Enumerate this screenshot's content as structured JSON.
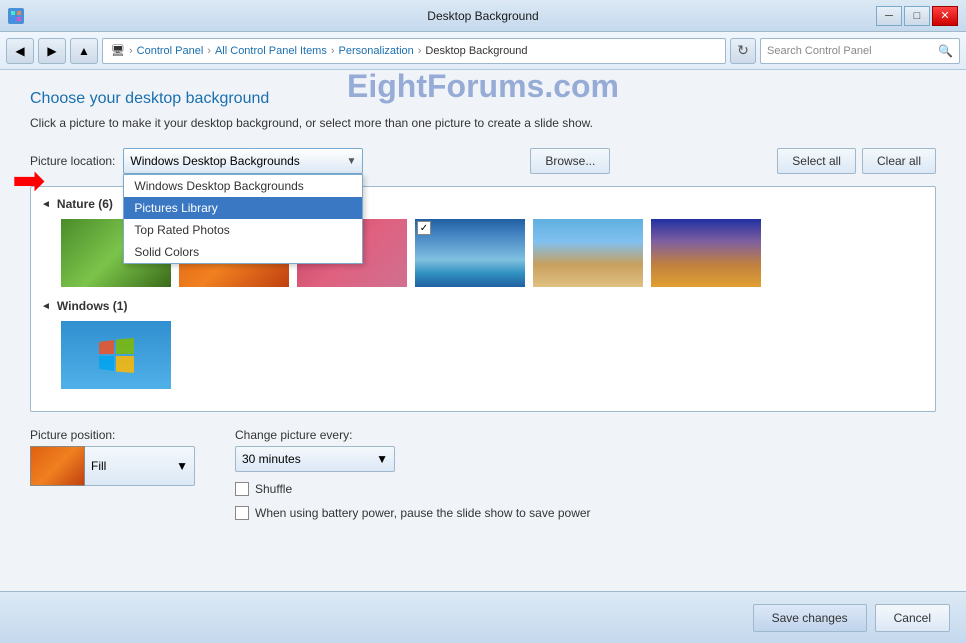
{
  "window": {
    "title": "Desktop Background",
    "icon": "🖥"
  },
  "titlebar_buttons": {
    "minimize": "─",
    "maximize": "□",
    "close": "✕"
  },
  "addressbar": {
    "breadcrumb": [
      "Control Panel",
      "All Control Panel Items",
      "Personalization",
      "Desktop Background"
    ],
    "search_placeholder": "Search Control Panel"
  },
  "page": {
    "title": "Choose your desktop background",
    "subtitle": "Click a picture to make it your desktop background, or select more than one picture to create a slide show."
  },
  "picture_location": {
    "label": "Picture location:",
    "selected": "Windows Desktop Backgrounds",
    "options": [
      "Windows Desktop Backgrounds",
      "Pictures Library",
      "Top Rated Photos",
      "Solid Colors"
    ]
  },
  "buttons": {
    "browse": "Browse...",
    "select_all": "Select all",
    "clear_all": "Clear all",
    "save_changes": "Save changes",
    "cancel": "Cancel"
  },
  "groups": [
    {
      "name": "Nature (6)",
      "images": 6
    },
    {
      "name": "Windows (1)",
      "images": 1
    }
  ],
  "picture_position": {
    "label": "Picture position:",
    "value": "Fill"
  },
  "change_picture": {
    "label": "Change picture every:",
    "value": "30 minutes"
  },
  "shuffle": {
    "label": "Shuffle",
    "checked": false
  },
  "battery": {
    "label": "When using battery power, pause the slide show to save power",
    "checked": false
  },
  "watermark": "EightForums.com"
}
